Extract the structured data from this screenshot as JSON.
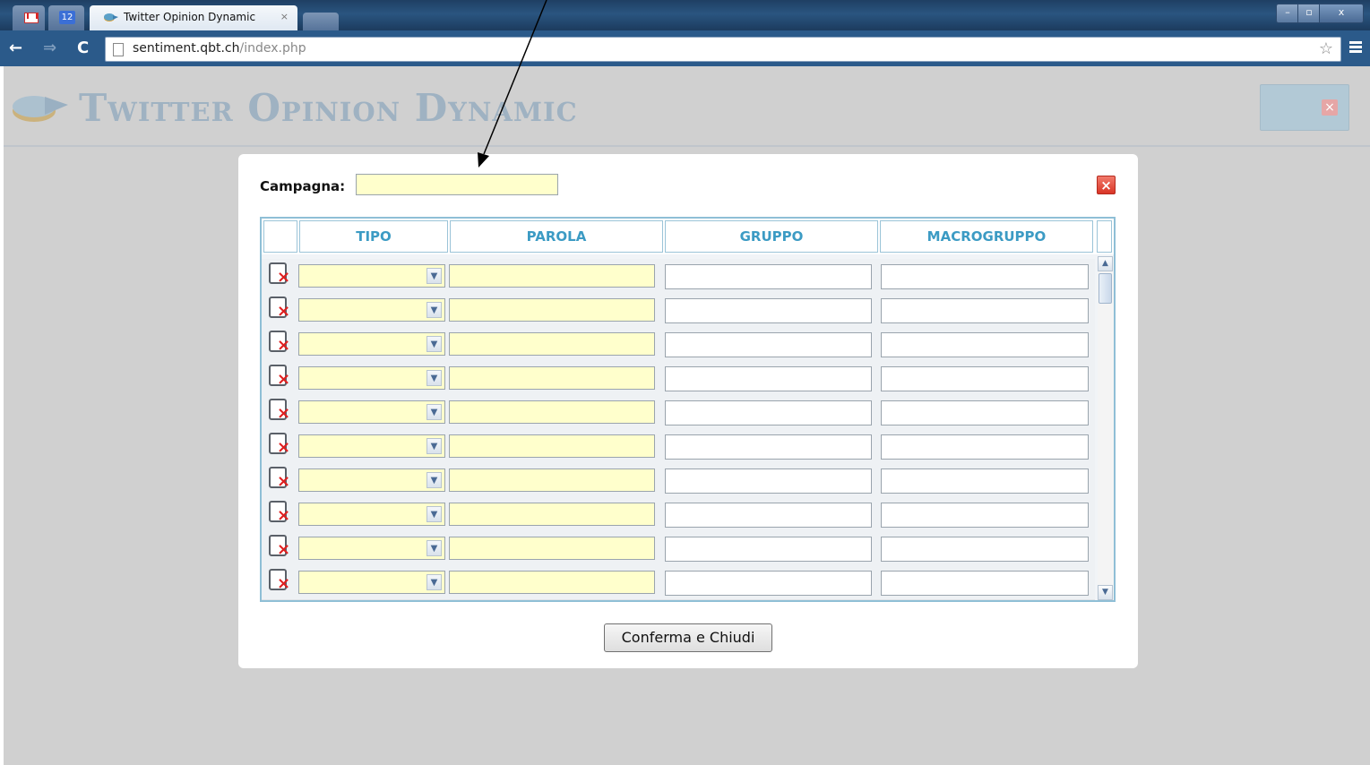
{
  "browser": {
    "tabs": [
      {
        "label": "",
        "icon": "gmail-icon"
      },
      {
        "label": "12",
        "icon": "calendar-icon"
      },
      {
        "label": "Twitter Opinion Dynamic",
        "icon": "app-favicon",
        "close": "×"
      }
    ],
    "window_controls": {
      "minimize": "–",
      "maximize": "▫",
      "close": "x"
    },
    "url_host": "sentiment.qbt.ch",
    "url_path": "/index.php"
  },
  "app": {
    "title": "Twitter Opinion Dynamic",
    "header_close": "×"
  },
  "modal": {
    "campaign_label": "Campagna:",
    "campaign_value": "",
    "close_label": "×",
    "columns": [
      "TIPO",
      "PAROLA",
      "GRUPPO",
      "MACROGRUPPO"
    ],
    "row_count": 10,
    "confirm_label": "Conferma e Chiudi"
  },
  "colors": {
    "accent": "#3c9bc4",
    "input_highlight": "#ffffcc",
    "overlay": "#d0d0d0"
  }
}
